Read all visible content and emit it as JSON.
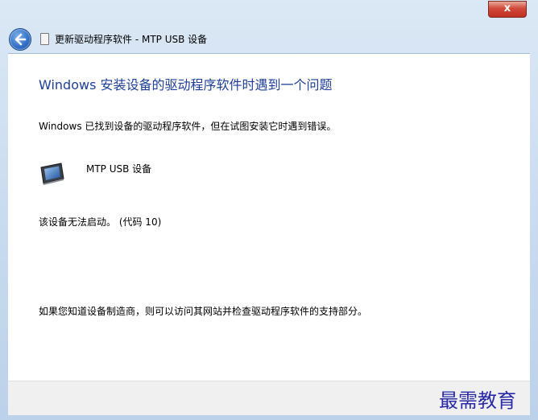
{
  "window": {
    "title": "更新驱动程序软件 - MTP USB 设备",
    "close_label": "x"
  },
  "icons": {
    "back": "back-arrow-icon",
    "title": "device-icon",
    "device": "media-player-icon"
  },
  "content": {
    "heading": "Windows 安装设备的驱动程序软件时遇到一个问题",
    "description": "Windows 已找到设备的驱动程序软件，但在试图安装它时遇到错误。",
    "device_name": "MTP USB 设备",
    "error_message": "该设备无法启动。 (代码 10)",
    "support_text": "如果您知道设备制造商，则可以访问其网站并检查驱动程序软件的支持部分。"
  },
  "watermark": "最需教育",
  "colors": {
    "heading": "#1e3f9a",
    "frame": "#c6d9ee",
    "close": "#c03020"
  }
}
